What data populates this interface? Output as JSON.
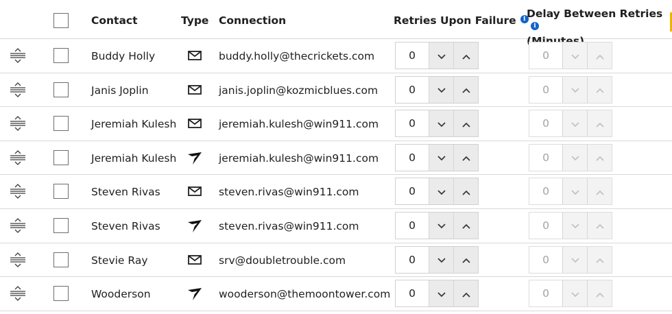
{
  "header": {
    "contact": "Contact",
    "type": "Type",
    "connection": "Connection",
    "retries": "Retries Upon Failure",
    "delay_line1": "Delay Between Retries",
    "delay_line2": "(Minutes)",
    "info_glyph": "i"
  },
  "rows": [
    {
      "contact": "Buddy Holly",
      "type_icon": "envelope-icon",
      "connection": "buddy.holly@thecrickets.com",
      "retries": "0",
      "delay": "0"
    },
    {
      "contact": "Janis Joplin",
      "type_icon": "envelope-icon",
      "connection": "janis.joplin@kozmicblues.com",
      "retries": "0",
      "delay": "0"
    },
    {
      "contact": "Jeremiah Kulesh",
      "type_icon": "envelope-icon",
      "connection": "jeremiah.kulesh@win911.com",
      "retries": "0",
      "delay": "0"
    },
    {
      "contact": "Jeremiah Kulesh",
      "type_icon": "win911-mobile-icon",
      "connection": "jeremiah.kulesh@win911.com",
      "retries": "0",
      "delay": "0"
    },
    {
      "contact": "Steven Rivas",
      "type_icon": "envelope-icon",
      "connection": "steven.rivas@win911.com",
      "retries": "0",
      "delay": "0"
    },
    {
      "contact": "Steven Rivas",
      "type_icon": "win911-mobile-icon",
      "connection": "steven.rivas@win911.com",
      "retries": "0",
      "delay": "0"
    },
    {
      "contact": "Stevie Ray",
      "type_icon": "envelope-icon",
      "connection": "srv@doubletrouble.com",
      "retries": "0",
      "delay": "0"
    },
    {
      "contact": "Wooderson",
      "type_icon": "win911-mobile-icon",
      "connection": "wooderson@themoontower.com",
      "retries": "0",
      "delay": "0"
    }
  ],
  "colors": {
    "info_icon": "#1464c8",
    "accent_marker": "#f0b400",
    "disabled_text": "#a3a3a3"
  }
}
